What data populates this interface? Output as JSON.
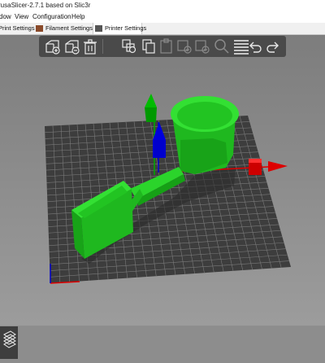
{
  "window": {
    "title": "rusaSlicer-2.7.1 based on Slic3r"
  },
  "menu": {
    "items": [
      "dow",
      "View",
      "Configuration",
      "Help"
    ]
  },
  "tabs": [
    {
      "label": "Print Settings",
      "icon": "print-settings-icon",
      "active": false
    },
    {
      "label": "Filament Settings",
      "icon": "filament-spool-icon",
      "active": false
    },
    {
      "label": "Printer Settings",
      "icon": "printer-icon",
      "active": true
    }
  ],
  "toolbar": {
    "tools": [
      "add-icon",
      "delete-icon",
      "delete-all-icon",
      "arrange-icon",
      "copy-icon",
      "paste-icon",
      "add-instance-icon",
      "remove-instance-icon",
      "search-icon",
      "layers-icon",
      "undo-icon",
      "redo-icon"
    ]
  },
  "colors": {
    "model": "#22cc22",
    "bed": "#3d3d3d",
    "grid_line": "#7a7a7a",
    "axis_x": "#dd0000",
    "axis_y": "#00aa00",
    "axis_z": "#0000cc",
    "toolbar_bg": "#4a4a4a"
  }
}
